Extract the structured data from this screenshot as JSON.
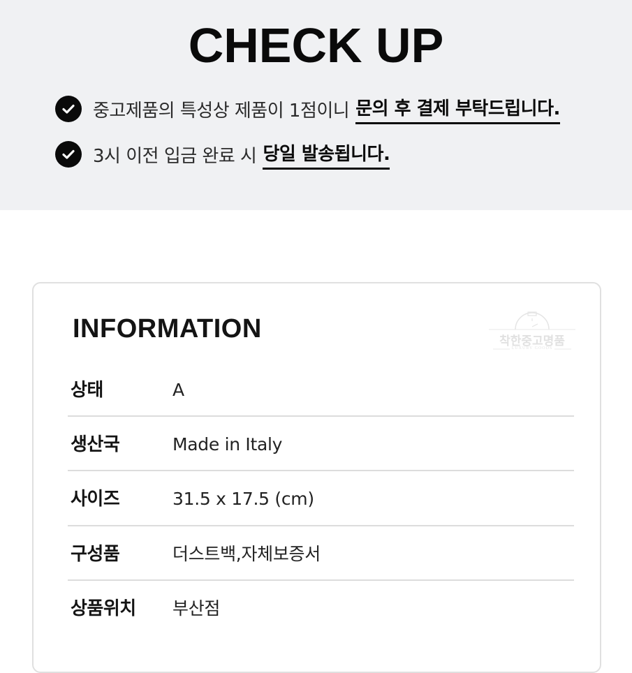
{
  "checkup": {
    "title": "CHECK UP",
    "notices": [
      {
        "icon": "check-circle-icon",
        "text": "중고제품의 특성상 제품이 1점이니",
        "emphasis": "문의 후 결제 부탁드립니다."
      },
      {
        "icon": "check-circle-icon",
        "text": "3시 이전 입금 완료 시",
        "emphasis": "당일 발송됩니다."
      }
    ]
  },
  "information": {
    "title": "INFORMATION",
    "watermark": {
      "name": "착한중고명품",
      "sub": "LUXURY GOODS"
    },
    "rows": [
      {
        "label": "상태",
        "value": "A"
      },
      {
        "label": "생산국",
        "value": "Made in Italy"
      },
      {
        "label": "사이즈",
        "value": "31.5 x 17.5 (cm)"
      },
      {
        "label": "구성품",
        "value": "더스트백,자체보증서"
      },
      {
        "label": "상품위치",
        "value": "부산점"
      }
    ]
  }
}
